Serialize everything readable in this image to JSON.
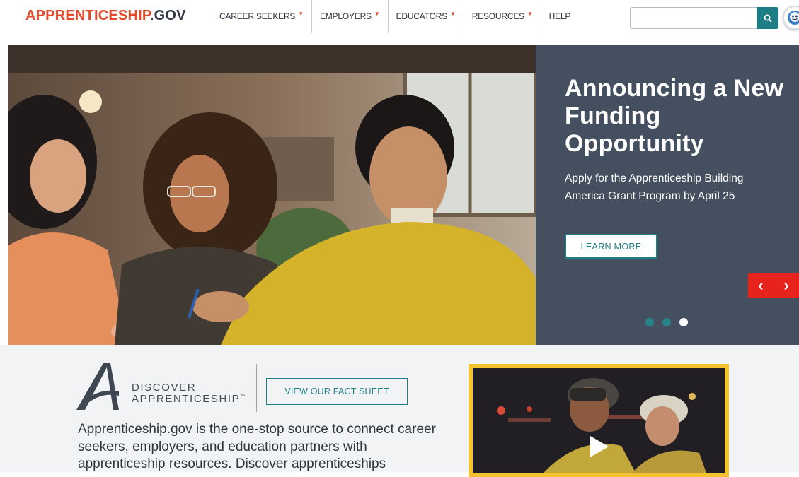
{
  "header": {
    "logo_part1": "APPRENTICESHIP",
    "logo_part2": ".GOV",
    "nav": [
      {
        "label": "CAREER SEEKERS",
        "caret": "▼"
      },
      {
        "label": "EMPLOYERS",
        "caret": "▼"
      },
      {
        "label": "EDUCATORS",
        "caret": "▼"
      },
      {
        "label": "RESOURCES",
        "caret": "▼"
      },
      {
        "label": "HELP",
        "caret": ""
      }
    ],
    "search": {
      "placeholder": "",
      "value": ""
    }
  },
  "hero": {
    "title": "Announcing a New Funding Opportunity",
    "text": "Apply for the Apprenticeship Building America Grant Program by April 25",
    "button_label": "LEARN MORE",
    "prev_label": "‹",
    "next_label": "›",
    "slides_total": 3,
    "active_slide": 3
  },
  "discover": {
    "logo_word1": "DISCOVER",
    "logo_word2": "APPRENTICESHIP",
    "logo_tm": "™",
    "fact_sheet_label": "VIEW OUR FACT SHEET",
    "intro": "Apprenticeship.gov is the one-stop source to connect career seekers, employers, and education partners with apprenticeship resources. Discover apprenticeships"
  },
  "colors": {
    "brand_red": "#e6482a",
    "teal": "#1f7d85",
    "panel": "#444f5f",
    "video_frame": "#f2c230",
    "carousel_arrows": "#e8231c"
  },
  "icons": [
    "search-icon",
    "chat-assistant-icon",
    "chevron-left-icon",
    "chevron-right-icon",
    "play-icon",
    "discover-a-logo-icon"
  ]
}
